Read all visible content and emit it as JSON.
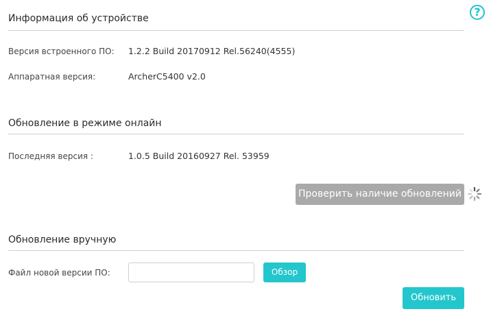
{
  "help": {
    "symbol": "?",
    "icon": "help-circle-icon",
    "color": "#1cc4ce"
  },
  "device_info": {
    "title": "Информация об устройстве",
    "firmware_label": "Версия встроенного ПО:",
    "firmware_value": "1.2.2 Build 20170912 Rel.56240(4555)",
    "hardware_label": "Аппаратная версия:",
    "hardware_value": "ArcherC5400 v2.0"
  },
  "online_update": {
    "title": "Обновление в режиме онлайн",
    "latest_label": "Последняя версия :",
    "latest_value": "1.0.5 Build 20160927 Rel. 53959",
    "check_button": "Проверить наличие обновлений",
    "spinner_icon": "loading-spinner-icon",
    "button_color": "#a9a9a9"
  },
  "manual_update": {
    "title": "Обновление вручную",
    "file_label": "Файл новой версии ПО:",
    "file_value": "",
    "browse_button": "Обзор",
    "update_button": "Обновить",
    "accent_color": "#23c6cc"
  }
}
